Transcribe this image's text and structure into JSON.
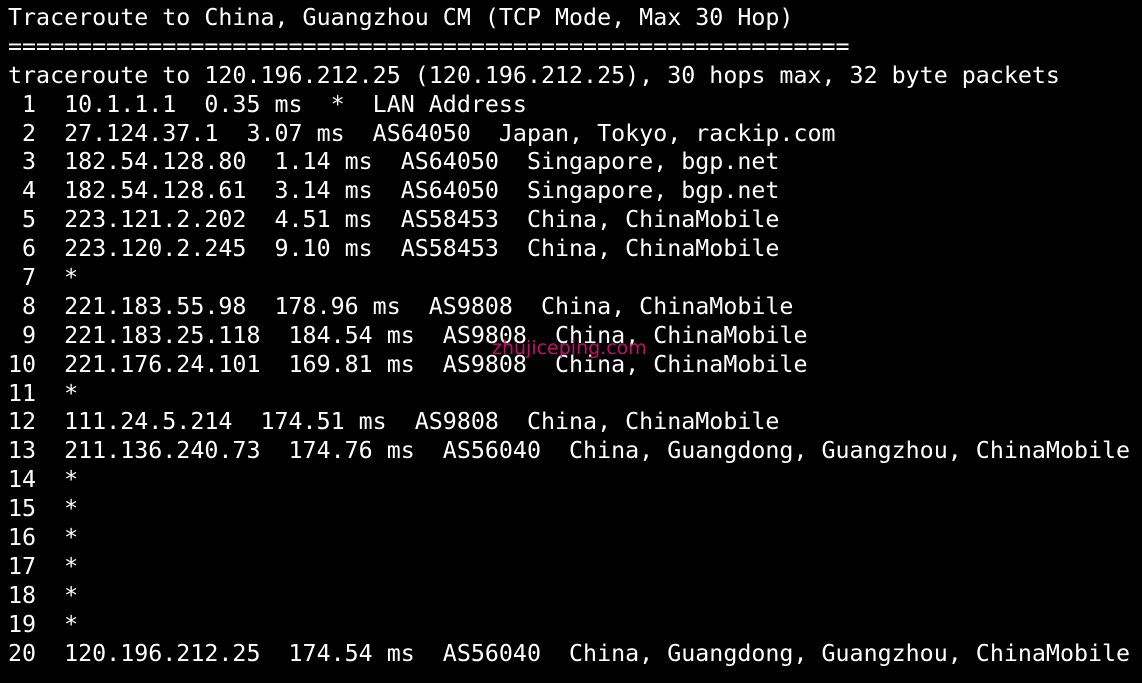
{
  "terminal": {
    "background": "#000000",
    "foreground": "#ffffff",
    "lines": [
      "Traceroute to China, Guangzhou CM (TCP Mode, Max 30 Hop)",
      "============================================================",
      "traceroute to 120.196.212.25 (120.196.212.25), 30 hops max, 32 byte packets",
      " 1  10.1.1.1  0.35 ms  *  LAN Address",
      " 2  27.124.37.1  3.07 ms  AS64050  Japan, Tokyo, rackip.com",
      " 3  182.54.128.80  1.14 ms  AS64050  Singapore, bgp.net",
      " 4  182.54.128.61  3.14 ms  AS64050  Singapore, bgp.net",
      " 5  223.121.2.202  4.51 ms  AS58453  China, ChinaMobile",
      " 6  223.120.2.245  9.10 ms  AS58453  China, ChinaMobile",
      " 7  *",
      " 8  221.183.55.98  178.96 ms  AS9808  China, ChinaMobile",
      " 9  221.183.25.118  184.54 ms  AS9808  China, ChinaMobile",
      "10  221.176.24.101  169.81 ms  AS9808  China, ChinaMobile",
      "11  *",
      "12  111.24.5.214  174.51 ms  AS9808  China, ChinaMobile",
      "13  211.136.240.73  174.76 ms  AS56040  China, Guangdong, Guangzhou, ChinaMobile",
      "14  *",
      "15  *",
      "16  *",
      "17  *",
      "18  *",
      "19  *",
      "20  120.196.212.25  174.54 ms  AS56040  China, Guangdong, Guangzhou, ChinaMobile"
    ]
  },
  "watermark": {
    "text": "zhujiceping.com",
    "color": "#d4137a"
  }
}
